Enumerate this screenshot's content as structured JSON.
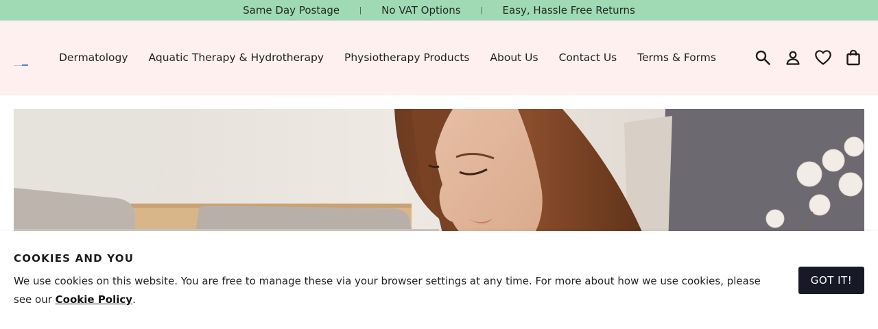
{
  "announcement": {
    "items": [
      "Same Day Postage",
      "No VAT Options",
      "Easy, Hassle Free Returns"
    ]
  },
  "header": {
    "nav": [
      {
        "label": "Dermatology"
      },
      {
        "label": "Aquatic Therapy & Hydrotherapy"
      },
      {
        "label": "Physiotherapy Products"
      },
      {
        "label": "About Us"
      },
      {
        "label": "Contact Us"
      },
      {
        "label": "Terms & Forms"
      }
    ],
    "icons": [
      "search-icon",
      "account-icon",
      "wishlist-icon",
      "cart-icon"
    ]
  },
  "cookie": {
    "title": "COOKIES AND YOU",
    "text": "We use cookies on this website. You are free to manage these via your browser settings at any time. For more about how we use cookies, please see our ",
    "link": "Cookie Policy",
    "end": ".",
    "button": "GOT IT!"
  },
  "colors": {
    "announcement_bg": "#a0dab4",
    "header_bg": "#fdf0ee",
    "button_bg": "#171a26"
  }
}
